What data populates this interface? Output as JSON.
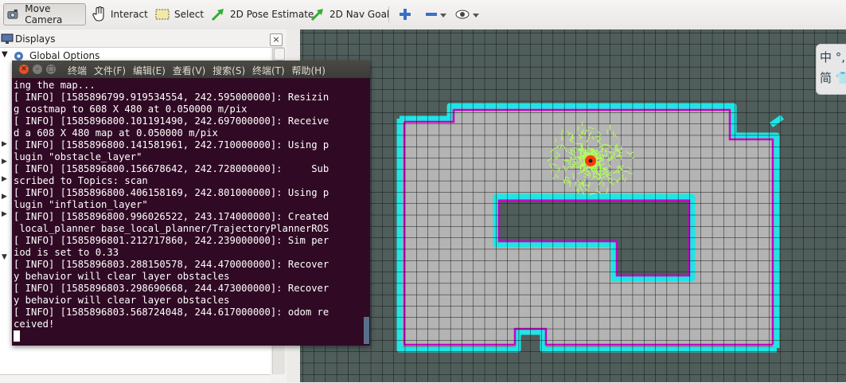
{
  "toolbar": {
    "tools": [
      {
        "label": "Move Camera",
        "icon": "move-camera-icon"
      },
      {
        "label": "Interact",
        "icon": "hand-icon"
      },
      {
        "label": "Select",
        "icon": "select-icon"
      },
      {
        "label": "2D Pose Estimate",
        "icon": "green-arrow-icon"
      },
      {
        "label": "2D Nav Goal",
        "icon": "green-arrow-icon"
      }
    ],
    "extra_icons": [
      "plus-icon",
      "minus-icon",
      "eye-icon"
    ]
  },
  "displays": {
    "title": "Displays",
    "close_label": "×",
    "tree": [
      {
        "label": "Global Options",
        "icon": "gear-icon"
      }
    ]
  },
  "ime": {
    "line1": "中 °,",
    "line2": "简 👕"
  },
  "terminal": {
    "title": "终端",
    "menu": [
      "文件(F)",
      "编辑(E)",
      "查看(V)",
      "搜索(S)",
      "终端(T)",
      "帮助(H)"
    ],
    "lines": [
      "ing the map...",
      "[ INFO] [1585896799.919534554, 242.595000000]: Resizin",
      "g costmap to 608 X 480 at 0.050000 m/pix",
      "[ INFO] [1585896800.101191490, 242.697000000]: Receive",
      "d a 608 X 480 map at 0.050000 m/pix",
      "[ INFO] [1585896800.141581961, 242.710000000]: Using p",
      "lugin \"obstacle_layer\"",
      "[ INFO] [1585896800.156678642, 242.728000000]:     Sub",
      "scribed to Topics: scan",
      "[ INFO] [1585896800.406158169, 242.801000000]: Using p",
      "lugin \"inflation_layer\"",
      "[ INFO] [1585896800.996026522, 243.174000000]: Created",
      " local_planner base_local_planner/TrajectoryPlannerROS",
      "[ INFO] [1585896801.212717860, 242.239000000]: Sim per",
      "iod is set to 0.33",
      "[ INFO] [1585896803.288150578, 244.470000000]: Recover",
      "y behavior will clear layer obstacles",
      "[ INFO] [1585896803.298690668, 244.473000000]: Recover",
      "y behavior will clear layer obstacles",
      "[ INFO] [1585896803.568724048, 244.617000000]: odom re",
      "ceived!"
    ]
  },
  "colors": {
    "terminal_bg": "#300a24",
    "map_unknown": "#4f5d5b",
    "map_free": "#b4b4b4",
    "inflation": "#1ee6e6",
    "obstacle": "#c800c8",
    "particles": "#b4ff5a",
    "robot": "#ff3c00"
  }
}
